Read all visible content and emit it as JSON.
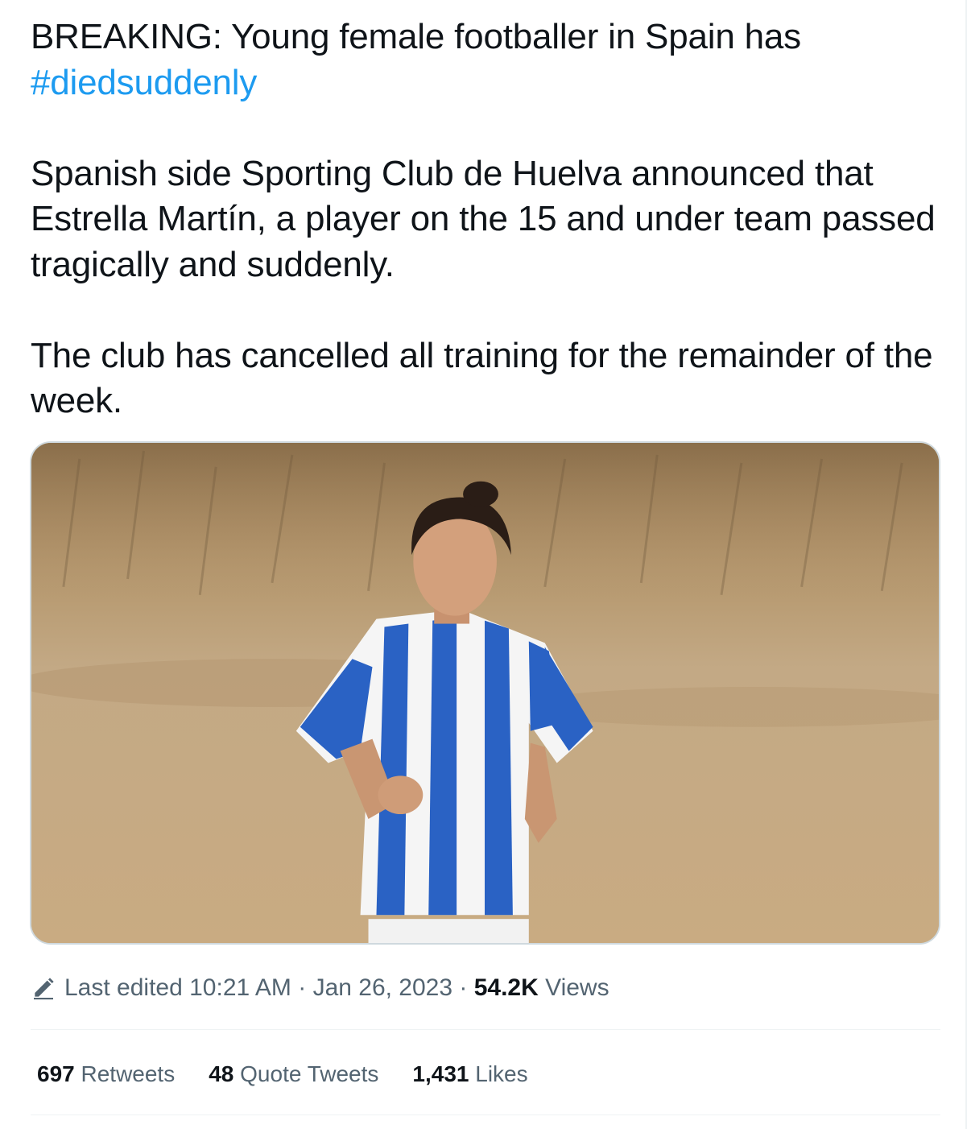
{
  "tweet": {
    "line1_text": "BREAKING: Young female footballer in Spain has ",
    "hashtag": "#diedsuddenly",
    "paragraph2": "Spanish side Sporting Club de Huelva announced that Estrella Martín, a player on the 15 and under team passed tragically and suddenly.",
    "paragraph3": "The club has cancelled all training for the remainder of the week."
  },
  "media": {
    "icon": "photo-football-player",
    "alt": ""
  },
  "meta": {
    "edit_icon": "pencil-icon",
    "last_edited_label": "Last edited ",
    "time": "10:21 AM",
    "sep1": " · ",
    "date": "Jan 26, 2023",
    "sep2": " · ",
    "views_count": "54.2K",
    "views_label": " Views"
  },
  "stats": {
    "retweets_count": "697",
    "retweets_label": " Retweets",
    "quotes_count": "48",
    "quotes_label": " Quote Tweets",
    "likes_count": "1,431",
    "likes_label": " Likes"
  },
  "colors": {
    "accent": "#1d9bf0",
    "text": "#0f1419",
    "secondary": "#536471",
    "border": "#cfd9de"
  }
}
